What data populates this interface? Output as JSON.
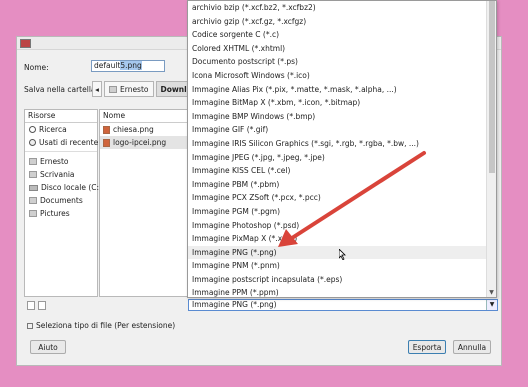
{
  "accent_color": "#d9443a",
  "dialog": {
    "name_label": "Nome:",
    "name_value_prefix": "default",
    "name_value_selected": "5.png",
    "save_in_label": "Salva nella cartella:",
    "nav_back": "◂",
    "breadcrumbs": [
      "Ernesto",
      "Downloads"
    ],
    "places_header": "Risorse",
    "places": [
      {
        "label": "Ricerca",
        "icon": "search-icon"
      },
      {
        "label": "Usati di recente",
        "icon": "recent-icon"
      },
      {
        "label": "Ernesto",
        "icon": "folder-icon"
      },
      {
        "label": "Scrivania",
        "icon": "folder-icon"
      },
      {
        "label": "Disco locale (C:)",
        "icon": "drive-icon"
      },
      {
        "label": "Documents",
        "icon": "folder-icon"
      },
      {
        "label": "Pictures",
        "icon": "folder-icon"
      }
    ],
    "files_header": "Nome",
    "files": [
      {
        "name": "chiesa.png"
      },
      {
        "name": "logo-ipcei.png"
      }
    ],
    "filetype_selected": "Immagine PNG (*.png)",
    "expander_label": "Seleziona tipo di file (Per estensione)",
    "help_button": "Aiuto",
    "export_button": "Esporta",
    "cancel_button": "Annulla"
  },
  "dropdown": {
    "items": [
      "archivio bzip (*.xcf.bz2, *.xcfbz2)",
      "archivio gzip (*.xcf.gz, *.xcfgz)",
      "Codice sorgente C (*.c)",
      "Colored XHTML (*.xhtml)",
      "Documento postscript (*.ps)",
      "Icona Microsoft Windows (*.ico)",
      "Immagine Alias Pix (*.pix, *.matte, *.mask, *.alpha, ...)",
      "Immagine BitMap X (*.xbm, *.icon, *.bitmap)",
      "Immagine BMP Windows (*.bmp)",
      "Immagine GIF (*.gif)",
      "Immagine IRIS Silicon Graphics (*.sgi, *.rgb, *.rgba, *.bw, ...)",
      "Immagine JPEG (*.jpg, *.jpeg, *.jpe)",
      "Immagine KISS CEL (*.cel)",
      "Immagine PBM (*.pbm)",
      "Immagine PCX ZSoft (*.pcx, *.pcc)",
      "Immagine PGM (*.pgm)",
      "Immagine Photoshop (*.psd)",
      "Immagine PixMap X (*.xpm)",
      "Immagine PNG (*.png)",
      "Immagine PNM (*.pnm)",
      "Immagine postscript incapsulata (*.eps)",
      "Immagine PPM (*.ppm)"
    ],
    "hover_index": 18
  }
}
